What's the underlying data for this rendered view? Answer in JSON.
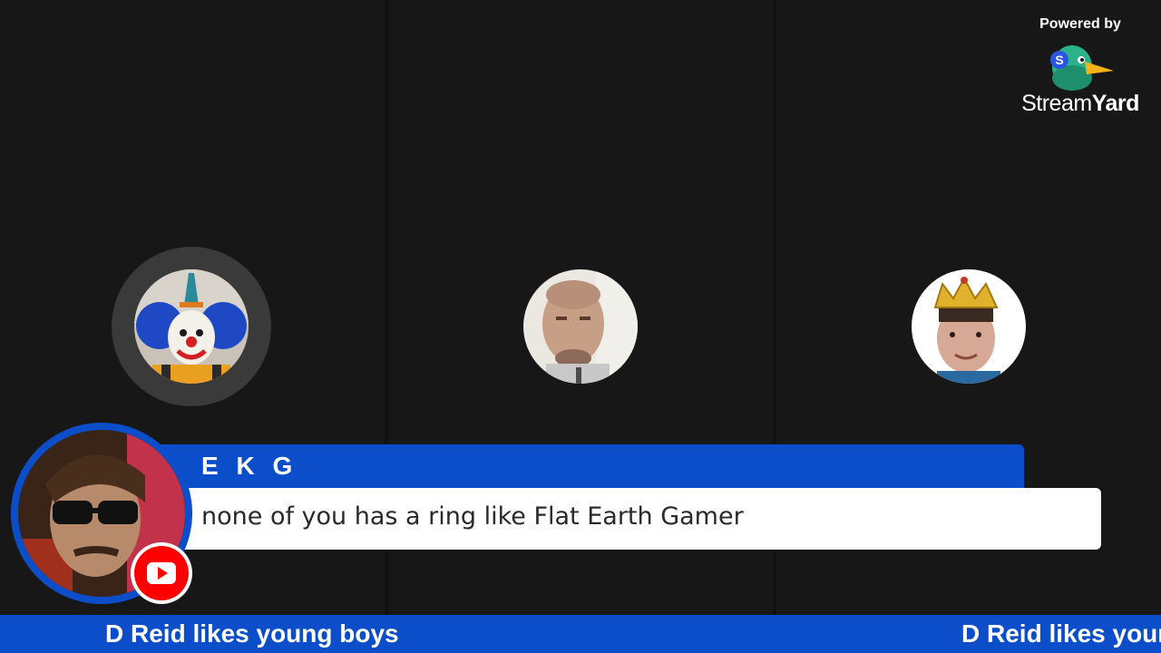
{
  "branding": {
    "powered_by": "Powered by",
    "wordmark_light": "Stream",
    "wordmark_bold": "Yard",
    "logo_icon": "streamyard-duck-icon"
  },
  "participants": [
    {
      "id": "participant-1",
      "avatar": "clown-avatar",
      "speaking": true
    },
    {
      "id": "participant-2",
      "avatar": "man-avatar"
    },
    {
      "id": "participant-3",
      "avatar": "crown-avatar"
    }
  ],
  "comment": {
    "author": "E K G",
    "message": "none of you has a ring like Flat Earth Gamer",
    "platform_icon": "youtube-icon"
  },
  "ticker": {
    "text": "D Reid likes young boys",
    "text_repeat": "D Reid likes youn"
  },
  "colors": {
    "accent": "#0c4ec9",
    "background": "#161616",
    "youtube": "#ff0000"
  }
}
